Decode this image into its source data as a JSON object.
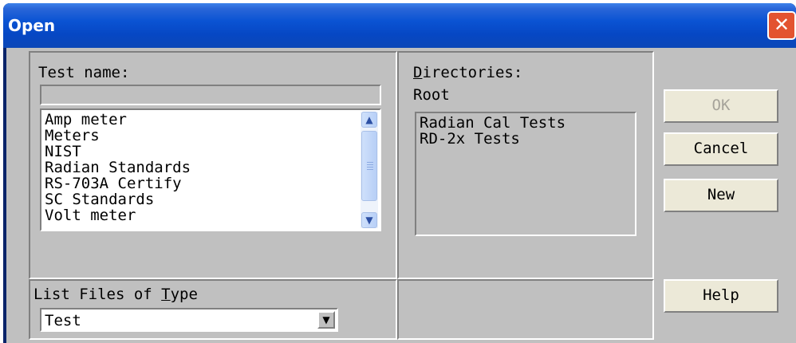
{
  "window": {
    "title": "Open"
  },
  "test_name": {
    "label": "Test name:",
    "value": "",
    "items": [
      "Amp meter",
      "Meters",
      "NIST",
      "Radian Standards",
      "RS-703A Certify",
      "SC Standards",
      "Volt meter"
    ]
  },
  "directories": {
    "label_rest": "irectories:",
    "label_mnemonic": "D",
    "current": "Root",
    "items": [
      "Radian Cal Tests",
      "RD-2x Tests"
    ]
  },
  "file_type": {
    "label_pre": "List Files of ",
    "label_mnemonic": "T",
    "label_post": "ype",
    "selected": "Test"
  },
  "buttons": {
    "ok": "OK",
    "cancel": "Cancel",
    "new": "New",
    "help": "Help"
  },
  "icons": {
    "close": "close-icon",
    "scroll_up": "chevron-up-icon",
    "scroll_down": "chevron-down-icon",
    "dropdown": "dropdown-arrow-icon"
  }
}
